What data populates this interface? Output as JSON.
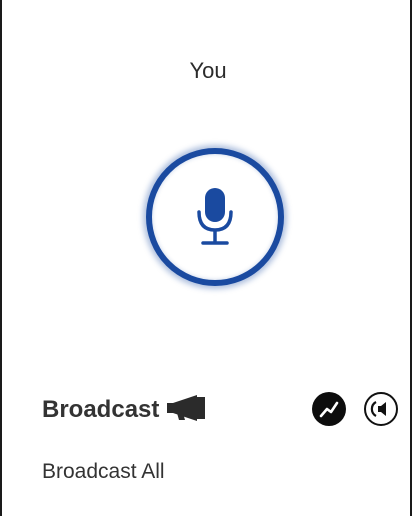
{
  "call": {
    "caller_name": "You"
  },
  "mic": {
    "icon": "microphone-icon",
    "color": "#1a4aa0"
  },
  "broadcast": {
    "title": "Broadcast",
    "title_icon": "megaphone-icon",
    "subtitle": "Broadcast All",
    "actions": [
      {
        "icon": "trend-chart-icon"
      },
      {
        "icon": "speaker-icon"
      }
    ]
  }
}
